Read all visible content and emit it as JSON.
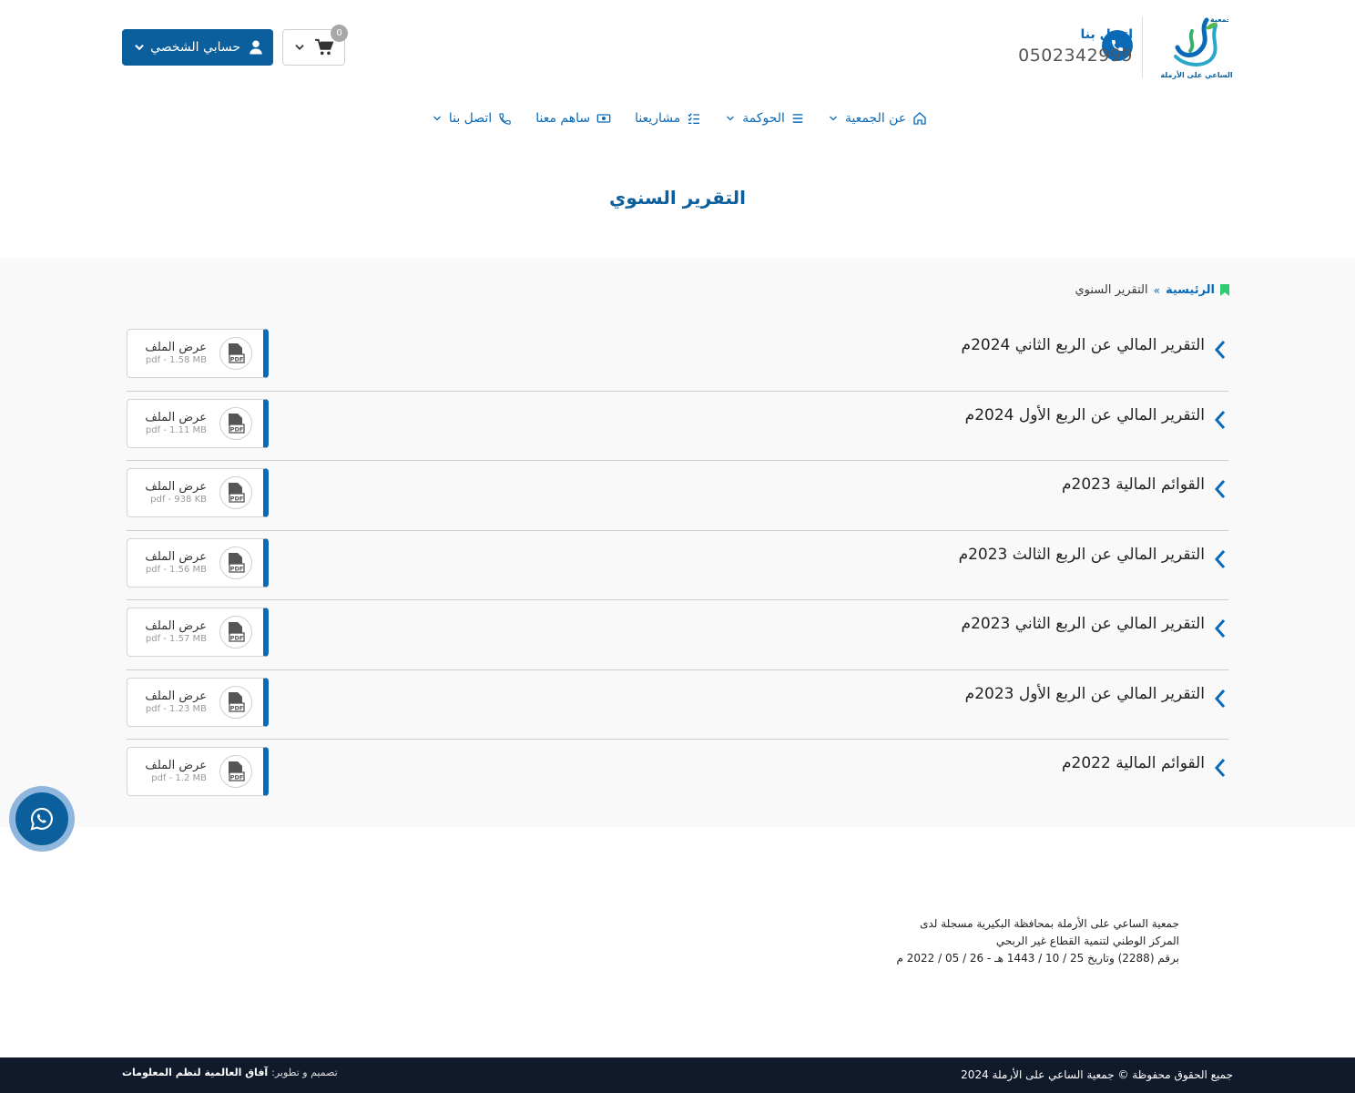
{
  "header": {
    "logo_text": "جمعية الساعي على الأرملة",
    "logo_caption": "الساعي على الأرملة",
    "contact_title": "اتصل بنا",
    "contact_phone": "0502342999",
    "cart_count": "0",
    "account_label": "حسابي الشخصي"
  },
  "nav": {
    "items": [
      {
        "label": "عن الجمعية",
        "icon": "home-icon",
        "dropdown": true
      },
      {
        "label": "الحوكمة",
        "icon": "list-icon",
        "dropdown": true
      },
      {
        "label": "مشاريعنا",
        "icon": "checklist-icon",
        "dropdown": false
      },
      {
        "label": "ساهم معنا",
        "icon": "money-icon",
        "dropdown": false
      },
      {
        "label": "اتصل بنا",
        "icon": "phone-icon",
        "dropdown": true
      }
    ]
  },
  "page": {
    "title": "التقرير السنوي"
  },
  "breadcrumb": {
    "home": "الرئيسية",
    "separator": "»",
    "current": "التقرير السنوي"
  },
  "files": [
    {
      "title": "التقرير المالي عن الربع الثاني 2024م",
      "action": "عرض الملف",
      "meta": "pdf - 1.58 MB"
    },
    {
      "title": "التقرير المالي عن الربع الأول 2024م",
      "action": "عرض الملف",
      "meta": "pdf - 1.11 MB"
    },
    {
      "title": "القوائم المالية 2023م",
      "action": "عرض الملف",
      "meta": "pdf - 938 KB"
    },
    {
      "title": "التقرير المالي عن الربع الثالث 2023م",
      "action": "عرض الملف",
      "meta": "pdf - 1.56 MB"
    },
    {
      "title": "التقرير المالي عن الربع الثاني 2023م",
      "action": "عرض الملف",
      "meta": "pdf - 1.57 MB"
    },
    {
      "title": "التقرير المالي عن الربع الأول 2023م",
      "action": "عرض الملف",
      "meta": "pdf - 1.23 MB"
    },
    {
      "title": "القوائم المالية 2022م",
      "action": "عرض الملف",
      "meta": "pdf - 1.2 MB"
    }
  ],
  "footer": {
    "note_lines": [
      "جمعية الساعي على الأرملة بمحافظة البكيرية مسجلة لدى",
      "المركز الوطني لتنمية القطاع غير الربحي",
      "برقم (2288) وتاريخ 25 / 10 / 1443 هـ - 26 / 05 / 2022 م"
    ],
    "copyright": "جميع الحقوق محفوظة © جمعية الساعي على الأرملة 2024",
    "credits_label": "تصميم و تطوير:",
    "credits_company": "آفاق العالمية لنظم المعلومات"
  },
  "colors": {
    "primary": "#0b5f9c",
    "accent": "#0b6ab8",
    "footer_bg": "#101a2b",
    "content_bg": "#f9f9f9"
  }
}
